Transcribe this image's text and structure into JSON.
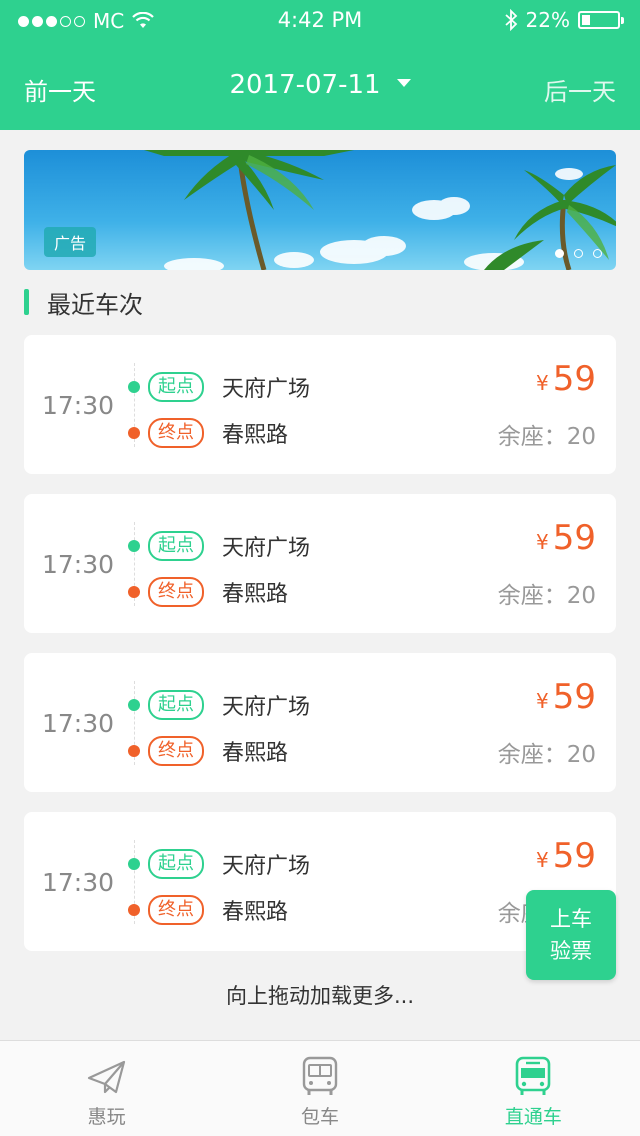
{
  "status_bar": {
    "carrier": "MC",
    "time": "4:42 PM",
    "battery": "22%"
  },
  "nav": {
    "prev_label": "前一天",
    "date": "2017-07-11",
    "next_label": "后一天"
  },
  "banner": {
    "ad_label": "广告",
    "slide_count": 3,
    "active_slide": 0
  },
  "section": {
    "title": "最近车次"
  },
  "trips": [
    {
      "time": "17:30",
      "start_tag": "起点",
      "start_station": "天府广场",
      "end_tag": "终点",
      "end_station": "春熙路",
      "currency": "¥",
      "price": "59",
      "seats": "余座：20"
    },
    {
      "time": "17:30",
      "start_tag": "起点",
      "start_station": "天府广场",
      "end_tag": "终点",
      "end_station": "春熙路",
      "currency": "¥",
      "price": "59",
      "seats": "余座：20"
    },
    {
      "time": "17:30",
      "start_tag": "起点",
      "start_station": "天府广场",
      "end_tag": "终点",
      "end_station": "春熙路",
      "currency": "¥",
      "price": "59",
      "seats": "余座：20"
    },
    {
      "time": "17:30",
      "start_tag": "起点",
      "start_station": "天府广场",
      "end_tag": "终点",
      "end_station": "春熙路",
      "currency": "¥",
      "price": "59",
      "seats": "余座：20"
    }
  ],
  "load_more": "向上拖动加载更多...",
  "float_button": {
    "line1": "上车",
    "line2": "验票"
  },
  "tabbar": {
    "items": [
      {
        "label": "惠玩",
        "icon": "paper-plane-icon",
        "active": false
      },
      {
        "label": "包车",
        "icon": "bus-charter-icon",
        "active": false
      },
      {
        "label": "直通车",
        "icon": "bus-direct-icon",
        "active": true
      }
    ]
  },
  "colors": {
    "primary": "#2ed18f",
    "accent": "#f0612a"
  }
}
